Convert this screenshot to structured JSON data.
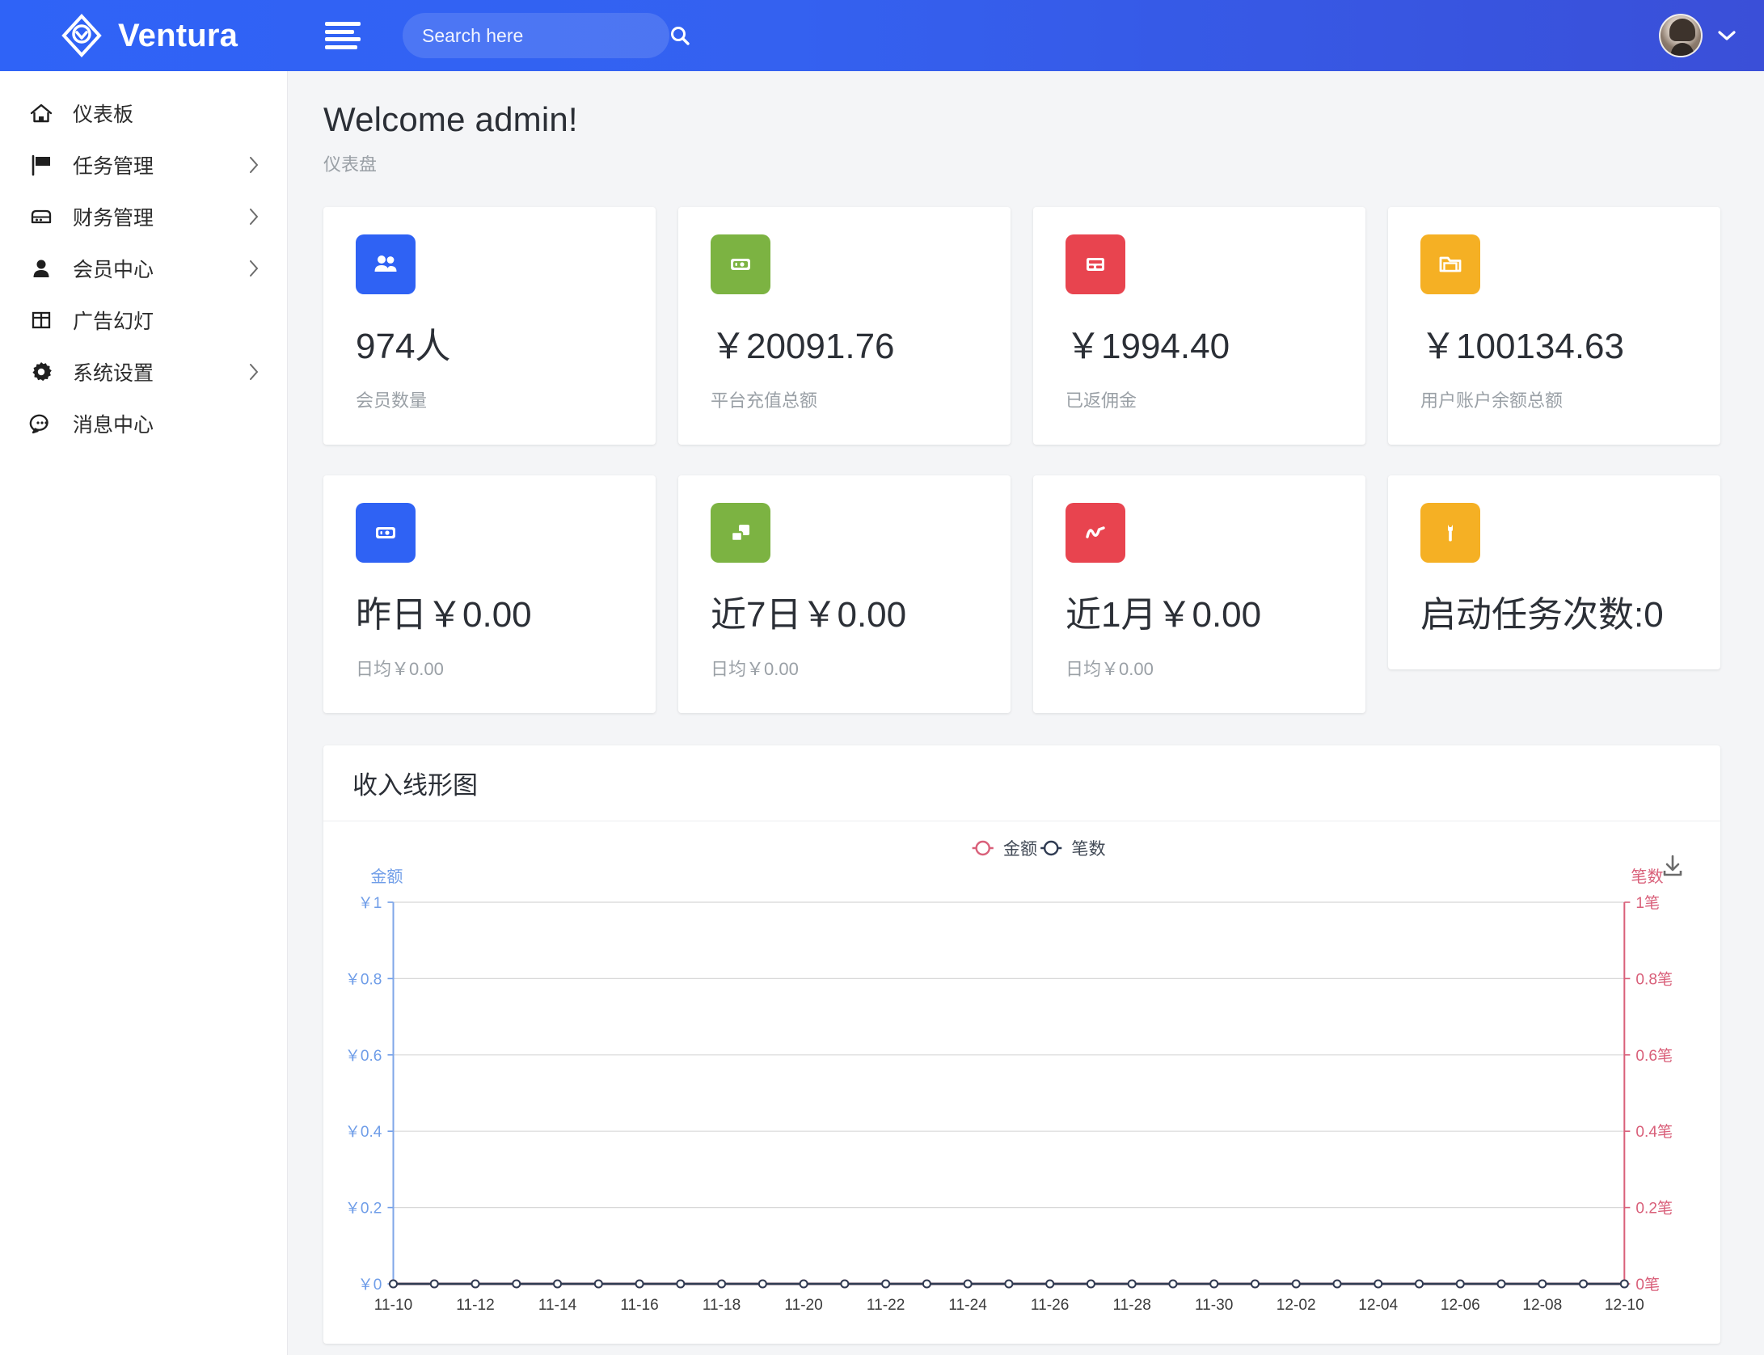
{
  "header": {
    "brand": "Ventura",
    "brand_logo_icon": "diamond-chevron-logo",
    "menu_toggle_icon": "hamburger-icon",
    "search": {
      "placeholder": "Search here",
      "value": "",
      "icon": "search-icon"
    },
    "avatar_icon": "user-avatar",
    "dropdown_icon": "chevron-down-icon"
  },
  "sidebar": {
    "items": [
      {
        "label": "仪表板",
        "icon": "home-icon",
        "has_submenu": false
      },
      {
        "label": "任务管理",
        "icon": "flag-icon",
        "has_submenu": true
      },
      {
        "label": "财务管理",
        "icon": "server-icon",
        "has_submenu": true
      },
      {
        "label": "会员中心",
        "icon": "user-icon",
        "has_submenu": true
      },
      {
        "label": "广告幻灯",
        "icon": "grid-icon",
        "has_submenu": false
      },
      {
        "label": "系统设置",
        "icon": "gear-icon",
        "has_submenu": true
      },
      {
        "label": "消息中心",
        "icon": "chat-icon",
        "has_submenu": false
      }
    ]
  },
  "main": {
    "title": "Welcome admin!",
    "subtitle": "仪表盘",
    "stat_rows": [
      [
        {
          "value": "974人",
          "label": "会员数量",
          "icon": "users-icon",
          "color": "#2f62f4"
        },
        {
          "value": "￥20091.76",
          "label": "平台充值总额",
          "icon": "banknote-icon",
          "color": "#7cb342"
        },
        {
          "value": "￥1994.40",
          "label": "已返佣金",
          "icon": "calculator-icon",
          "color": "#e8444f"
        },
        {
          "value": "￥100134.63",
          "label": "用户账户余额总额",
          "icon": "folder-icon",
          "color": "#f5b024"
        }
      ],
      [
        {
          "value": "昨日￥0.00",
          "label": "日均￥0.00",
          "icon": "banknote-icon",
          "color": "#2f62f4"
        },
        {
          "value": "近7日￥0.00",
          "label": "日均￥0.00",
          "icon": "layers-icon",
          "color": "#7cb342"
        },
        {
          "value": "近1月￥0.00",
          "label": "日均￥0.00",
          "icon": "trend-icon",
          "color": "#e8444f"
        },
        {
          "value": "启动任务次数:0",
          "label": "",
          "icon": "wrench-icon",
          "color": "#f5b024"
        }
      ]
    ]
  },
  "chart_panel": {
    "title": "收入线形图",
    "download_icon": "download-icon"
  },
  "chart_data": {
    "type": "line",
    "title": "收入线形图",
    "xlabel": "",
    "x": [
      "11-10",
      "11-11",
      "11-12",
      "11-13",
      "11-14",
      "11-15",
      "11-16",
      "11-17",
      "11-18",
      "11-19",
      "11-20",
      "11-21",
      "11-22",
      "11-23",
      "11-24",
      "11-25",
      "11-26",
      "11-27",
      "11-28",
      "11-29",
      "11-30",
      "12-01",
      "12-02",
      "12-03",
      "12-04",
      "12-05",
      "12-06",
      "12-07",
      "12-08",
      "12-09",
      "12-10"
    ],
    "tick_labels": [
      "11-10",
      "11-12",
      "11-14",
      "11-16",
      "11-18",
      "11-20",
      "11-22",
      "11-24",
      "11-26",
      "11-28",
      "11-30",
      "12-02",
      "12-04",
      "12-06",
      "12-08",
      "12-10"
    ],
    "legend": [
      "金额",
      "笔数"
    ],
    "legend_position": "top-center",
    "grid": true,
    "axes": [
      {
        "name": "金额",
        "side": "left",
        "color": "#6f9de8",
        "ylim": [
          0,
          1
        ],
        "ticks": [
          0,
          0.2,
          0.4,
          0.6,
          0.8,
          1
        ],
        "tick_labels": [
          "￥0",
          "￥0.2",
          "￥0.4",
          "￥0.6",
          "￥0.8",
          "￥1"
        ]
      },
      {
        "name": "笔数",
        "side": "right",
        "color": "#d9607a",
        "ylim": [
          0,
          1
        ],
        "ticks": [
          0,
          0.2,
          0.4,
          0.6,
          0.8,
          1
        ],
        "tick_labels": [
          "0笔",
          "0.2笔",
          "0.4笔",
          "0.6笔",
          "0.8笔",
          "1笔"
        ]
      }
    ],
    "series": [
      {
        "name": "金额",
        "axis": "left",
        "color": "#d9607a",
        "values": [
          0,
          0,
          0,
          0,
          0,
          0,
          0,
          0,
          0,
          0,
          0,
          0,
          0,
          0,
          0,
          0,
          0,
          0,
          0,
          0,
          0,
          0,
          0,
          0,
          0,
          0,
          0,
          0,
          0,
          0,
          0
        ]
      },
      {
        "name": "笔数",
        "axis": "right",
        "color": "#2f3b52",
        "values": [
          0,
          0,
          0,
          0,
          0,
          0,
          0,
          0,
          0,
          0,
          0,
          0,
          0,
          0,
          0,
          0,
          0,
          0,
          0,
          0,
          0,
          0,
          0,
          0,
          0,
          0,
          0,
          0,
          0,
          0,
          0
        ]
      }
    ]
  }
}
